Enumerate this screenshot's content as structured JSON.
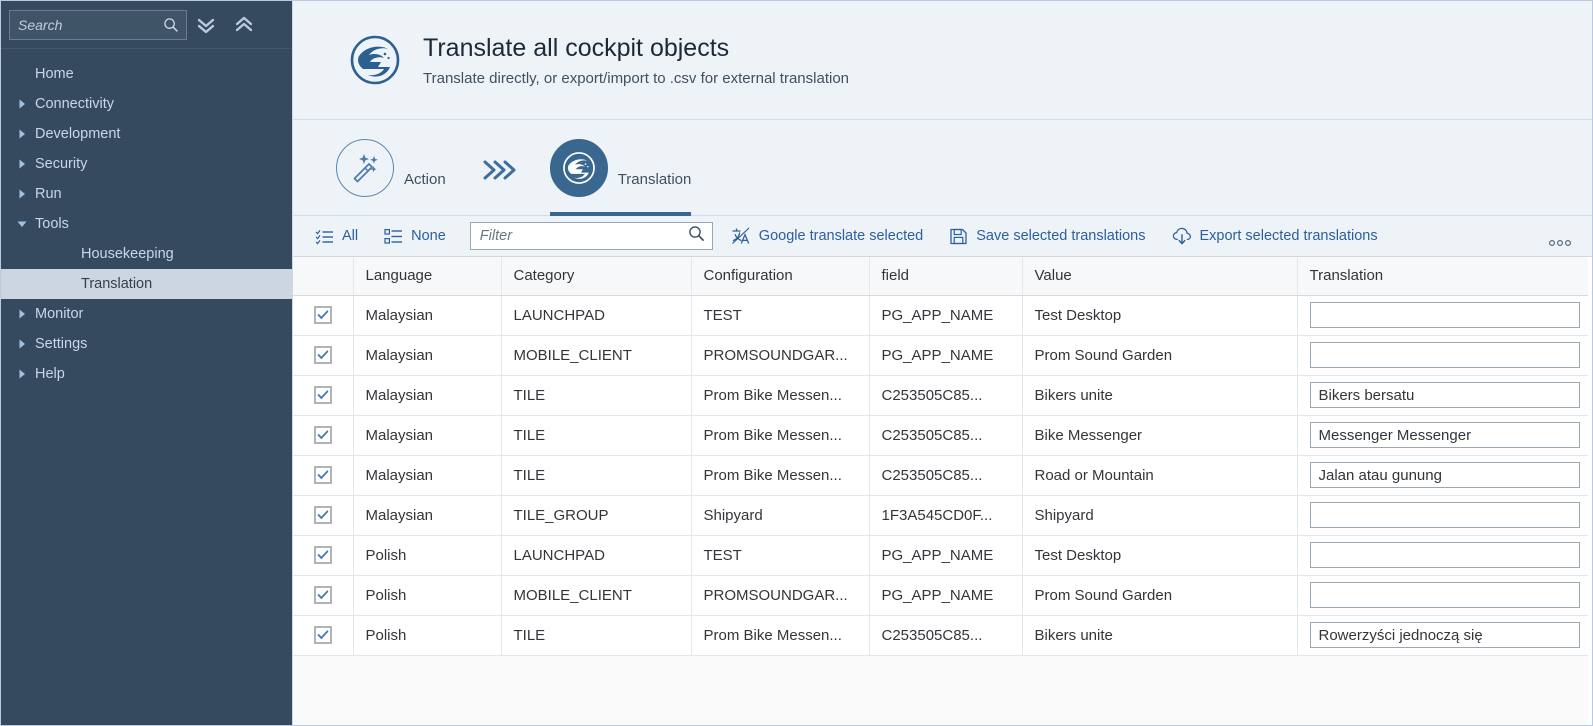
{
  "sidebar": {
    "search": {
      "placeholder": "Search",
      "value": ""
    },
    "expand_all_label": "expand-all",
    "collapse_all_label": "collapse-all",
    "items": [
      {
        "label": "Home",
        "expandable": false,
        "level": 0,
        "state": "none",
        "selected": false
      },
      {
        "label": "Connectivity",
        "expandable": true,
        "level": 0,
        "state": "collapsed",
        "selected": false
      },
      {
        "label": "Development",
        "expandable": true,
        "level": 0,
        "state": "collapsed",
        "selected": false
      },
      {
        "label": "Security",
        "expandable": true,
        "level": 0,
        "state": "collapsed",
        "selected": false
      },
      {
        "label": "Run",
        "expandable": true,
        "level": 0,
        "state": "collapsed",
        "selected": false
      },
      {
        "label": "Tools",
        "expandable": true,
        "level": 0,
        "state": "expanded",
        "selected": false
      },
      {
        "label": "Housekeeping",
        "expandable": false,
        "level": 1,
        "state": "none",
        "selected": false
      },
      {
        "label": "Translation",
        "expandable": false,
        "level": 1,
        "state": "none",
        "selected": true
      },
      {
        "label": "Monitor",
        "expandable": true,
        "level": 0,
        "state": "collapsed",
        "selected": false
      },
      {
        "label": "Settings",
        "expandable": true,
        "level": 0,
        "state": "collapsed",
        "selected": false
      },
      {
        "label": "Help",
        "expandable": true,
        "level": 0,
        "state": "collapsed",
        "selected": false
      }
    ]
  },
  "header": {
    "title": "Translate all cockpit objects",
    "subtitle": "Translate directly, or export/import to .csv for external translation",
    "icon": "globe-translate-icon"
  },
  "wizard": {
    "steps": [
      {
        "label": "Action",
        "icon": "magic-wand-icon",
        "active": false
      },
      {
        "label": "Translation",
        "icon": "globe-translate-icon",
        "active": true
      }
    ],
    "separator_icon": "chevrons-right-icon"
  },
  "toolbar": {
    "select_all_label": "All",
    "select_all_icon": "select-all-icon",
    "select_none_label": "None",
    "select_none_icon": "select-none-icon",
    "filter": {
      "placeholder": "Filter",
      "value": ""
    },
    "filter_icon": "search-icon",
    "google_translate_label": "Google translate selected",
    "google_translate_icon": "translate-icon",
    "save_label": "Save selected translations",
    "save_icon": "floppy-disk-icon",
    "export_label": "Export selected translations",
    "export_icon": "download-cloud-icon",
    "overflow_label": "···",
    "overflow_icon": "overflow-dots-icon"
  },
  "table": {
    "columns": [
      "",
      "Language",
      "Category",
      "Configuration",
      "field",
      "Value",
      "Translation"
    ],
    "rows": [
      {
        "checked": true,
        "language": "Malaysian",
        "category": "LAUNCHPAD",
        "configuration": "TEST",
        "field": "PG_APP_NAME",
        "value": "Test Desktop",
        "translation": ""
      },
      {
        "checked": true,
        "language": "Malaysian",
        "category": "MOBILE_CLIENT",
        "configuration": "PROMSOUNDGAR...",
        "field": "PG_APP_NAME",
        "value": "Prom Sound Garden",
        "translation": ""
      },
      {
        "checked": true,
        "language": "Malaysian",
        "category": "TILE",
        "configuration": "Prom Bike Messen...",
        "field": "C253505C85...",
        "value": "Bikers unite",
        "translation": "Bikers bersatu"
      },
      {
        "checked": true,
        "language": "Malaysian",
        "category": "TILE",
        "configuration": "Prom Bike Messen...",
        "field": "C253505C85...",
        "value": "Bike Messenger",
        "translation": "Messenger Messenger"
      },
      {
        "checked": true,
        "language": "Malaysian",
        "category": "TILE",
        "configuration": "Prom Bike Messen...",
        "field": "C253505C85...",
        "value": "Road or Mountain",
        "translation": "Jalan atau gunung"
      },
      {
        "checked": true,
        "language": "Malaysian",
        "category": "TILE_GROUP",
        "configuration": "Shipyard",
        "field": "1F3A545CD0F...",
        "value": "Shipyard",
        "translation": ""
      },
      {
        "checked": true,
        "language": "Polish",
        "category": "LAUNCHPAD",
        "configuration": "TEST",
        "field": "PG_APP_NAME",
        "value": "Test Desktop",
        "translation": ""
      },
      {
        "checked": true,
        "language": "Polish",
        "category": "MOBILE_CLIENT",
        "configuration": "PROMSOUNDGAR...",
        "field": "PG_APP_NAME",
        "value": "Prom Sound Garden",
        "translation": ""
      },
      {
        "checked": true,
        "language": "Polish",
        "category": "TILE",
        "configuration": "Prom Bike Messen...",
        "field": "C253505C85...",
        "value": "Bikers unite",
        "translation": "Rowerzyści jednoczą się"
      }
    ]
  },
  "colors": {
    "sidebar_bg": "#354a5f",
    "accent_blue": "#2b5f9e",
    "step_active": "#39678f",
    "header_bg": "#eef3f8",
    "selected_nav_bg": "#ccd6e0"
  }
}
